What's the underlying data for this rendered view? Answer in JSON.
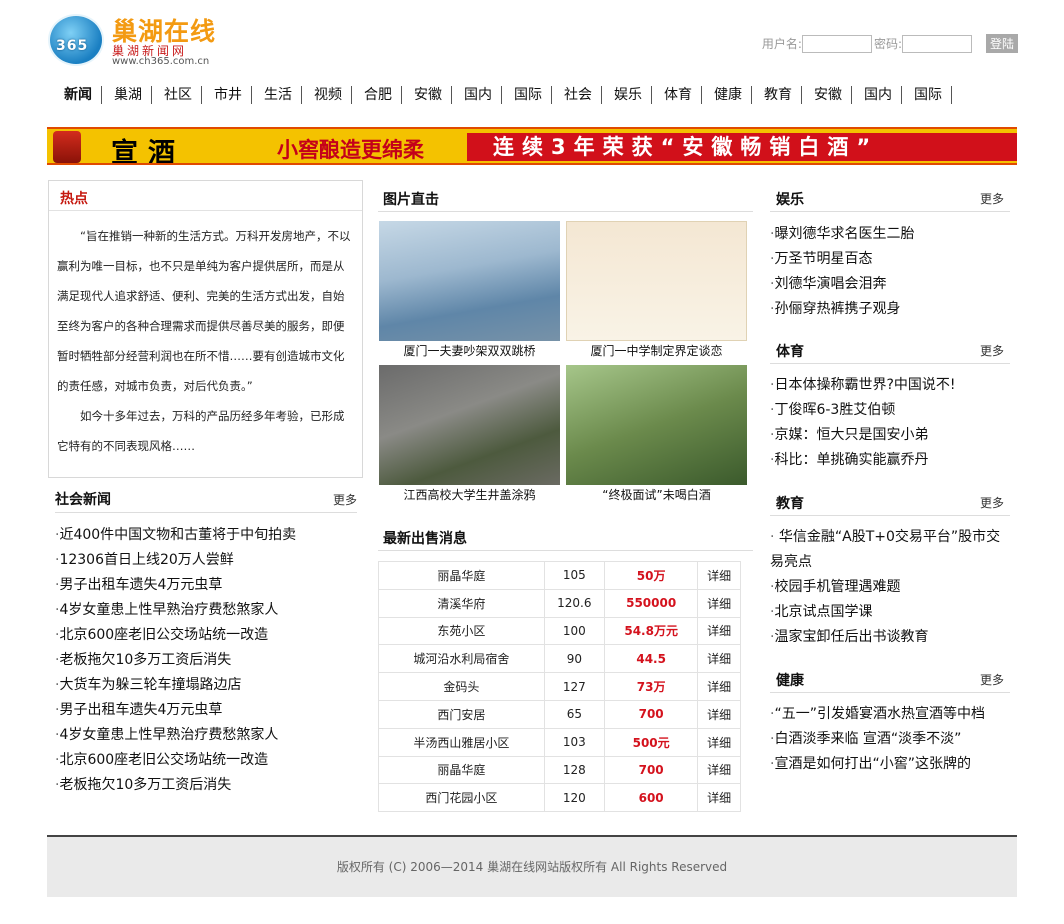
{
  "header": {
    "logo_badge": "365",
    "logo_title": "巢湖在线",
    "logo_sub": "巢湖新闻网",
    "logo_url": "www.ch365.com.cn",
    "username_label": "用户名:",
    "password_label": "密码:",
    "login_button": "登陆"
  },
  "nav": [
    "新闻",
    "巢湖",
    "社区",
    "市井",
    "生活",
    "视频",
    "合肥",
    "安徽",
    "国内",
    "国际",
    "社会",
    "娱乐",
    "体育",
    "健康",
    "教育",
    "安徽",
    "国内",
    "国际"
  ],
  "banner": {
    "brand": "宣酒",
    "slogan": "小窖酿造更绵柔",
    "award": "连续3年荣获“安徽畅销白酒”"
  },
  "hot": {
    "title": "热点",
    "para1": "“旨在推销一种新的生活方式。万科开发房地产，不以赢利为唯一目标，也不只是单纯为客户提供居所，而是从满足现代人追求舒适、便利、完美的生活方式出发，自始至终为客户的各种合理需求而提供尽善尽美的服务，即便暂时牺牲部分经营利润也在所不惜……要有创造城市文化的责任感，对城市负责，对后代负责。”",
    "para2": "如今十多年过去，万科的产品历经多年考验，已形成它特有的不同表现风格……"
  },
  "social": {
    "title": "社会新闻",
    "more": "更多",
    "items": [
      "近400件中国文物和古董将于中旬拍卖",
      "12306首日上线20万人尝鲜",
      "男子出租车遗失4万元虫草",
      "4岁女童患上性早熟治疗费愁煞家人",
      "北京600座老旧公交场站统一改造",
      "老板拖欠10多万工资后消失",
      "大货车为躲三轮车撞塌路边店",
      "男子出租车遗失4万元虫草",
      "4岁女童患上性早熟治疗费愁煞家人",
      "北京600座老旧公交场站统一改造",
      "老板拖欠10多万工资后消失"
    ]
  },
  "photos": {
    "title": "图片直击",
    "items": [
      {
        "caption": "厦门一夫妻吵架双双跳桥"
      },
      {
        "caption": "厦门一中学制定界定谈恋"
      },
      {
        "caption": "江西高校大学生井盖涂鸦"
      },
      {
        "caption": "“终极面试”未喝白酒"
      }
    ]
  },
  "sales": {
    "title": "最新出售消息",
    "rows": [
      {
        "name": "丽晶华庭",
        "area": "105",
        "price": "50万",
        "link": "详细"
      },
      {
        "name": "清溪华府",
        "area": "120.6",
        "price": "550000",
        "link": "详细"
      },
      {
        "name": "东苑小区",
        "area": "100",
        "price": "54.8万元",
        "link": "详细"
      },
      {
        "name": "城河沿水利局宿舍",
        "area": "90",
        "price": "44.5",
        "link": "详细"
      },
      {
        "name": "金码头",
        "area": "127",
        "price": "73万",
        "link": "详细"
      },
      {
        "name": "西门安居",
        "area": "65",
        "price": "700",
        "link": "详细"
      },
      {
        "name": "半汤西山雅居小区",
        "area": "103",
        "price": "500元",
        "link": "详细"
      },
      {
        "name": "丽晶华庭",
        "area": "128",
        "price": "700",
        "link": "详细"
      },
      {
        "name": "西门花园小区",
        "area": "120",
        "price": "600",
        "link": "详细"
      }
    ]
  },
  "ent": {
    "title": "娱乐",
    "more": "更多",
    "items": [
      "曝刘德华求名医生二胎",
      "万圣节明星百态",
      "刘德华演唱会泪奔",
      "孙俪穿热裤携子观身"
    ]
  },
  "sports": {
    "title": "体育",
    "more": "更多",
    "items": [
      "日本体操称霸世界?中国说不!",
      "丁俊晖6-3胜艾伯顿",
      "京媒：恒大只是国安小弟",
      "科比：单挑确实能赢乔丹"
    ]
  },
  "edu": {
    "title": "教育",
    "more": "更多",
    "items": [
      " 华信金融“A股T+0交易平台”股市交易亮点",
      "校园手机管理遇难题",
      "北京试点国学课",
      "温家宝卸任后出书谈教育"
    ]
  },
  "health": {
    "title": "健康",
    "more": "更多",
    "items": [
      "“五一”引发婚宴酒水热宣酒等中档",
      "白酒淡季来临 宣酒“淡季不淡”",
      "宣酒是如何打出“小窖”这张牌的"
    ]
  },
  "footer": {
    "text": "版权所有 (C) 2006—2014 巢湖在线网站版权所有 All Rights Reserved"
  }
}
